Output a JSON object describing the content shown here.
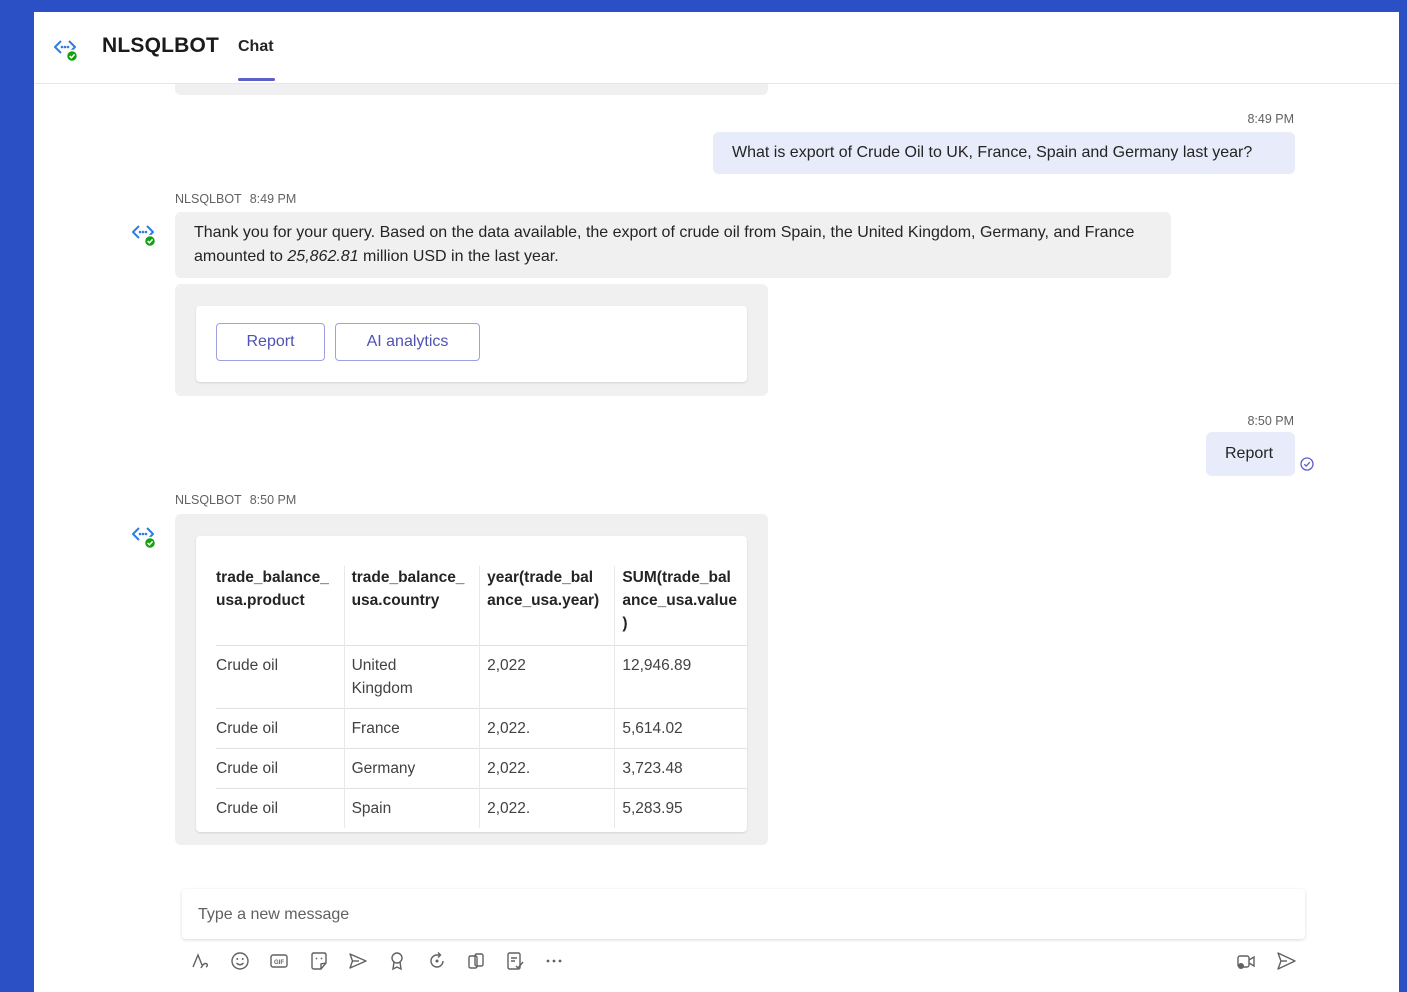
{
  "header": {
    "app_name": "NLSQLBOT",
    "tab_label": "Chat"
  },
  "messages": {
    "user1": {
      "time": "8:49 PM",
      "text": "What is export of Crude Oil to UK, France, Spain and Germany last year?"
    },
    "bot1": {
      "sender": "NLSQLBOT",
      "time": "8:49 PM",
      "text_before": "Thank you for your query. Based on the data available, the export of crude oil from Spain, the United Kingdom, Germany, and France amounted to ",
      "text_value": "25,862.81",
      "text_after": " million USD in the last year.",
      "buttons": {
        "report": "Report",
        "ai_analytics": "AI analytics"
      }
    },
    "user2": {
      "time": "8:50 PM",
      "text": "Report"
    },
    "bot2": {
      "sender": "NLSQLBOT",
      "time": "8:50 PM",
      "table": {
        "headers": [
          "trade_balance_\nusa.product",
          "trade_balance_\nusa.country",
          "year(trade_bal\nance_usa.year)",
          "SUM(trade_bal\nance_usa.value\n)"
        ],
        "rows": [
          [
            "Crude oil",
            "United\nKingdom",
            "2,022",
            "12,946.89"
          ],
          [
            "Crude oil",
            "France",
            "2,022.",
            "5,614.02"
          ],
          [
            "Crude oil",
            "Germany",
            "2,022.",
            "3,723.48"
          ],
          [
            "Crude oil",
            "Spain",
            "2,022.",
            "5,283.95"
          ]
        ]
      }
    }
  },
  "compose": {
    "placeholder": "Type a new message"
  },
  "colors": {
    "frame": "#2b4fc4",
    "accent": "#5b5fc7",
    "user_bubble": "#e8ebfa",
    "bot_bubble": "#f0f0f0",
    "status_green": "#13a10e"
  },
  "icons": {
    "toolbar": [
      "format-icon",
      "emoji-icon",
      "gif-icon",
      "sticker-icon",
      "schedule-send-icon",
      "praise-icon",
      "loop-icon",
      "apps-icon",
      "approvals-icon",
      "more-options-icon"
    ],
    "right": [
      "video-clip-icon",
      "send-icon"
    ]
  }
}
